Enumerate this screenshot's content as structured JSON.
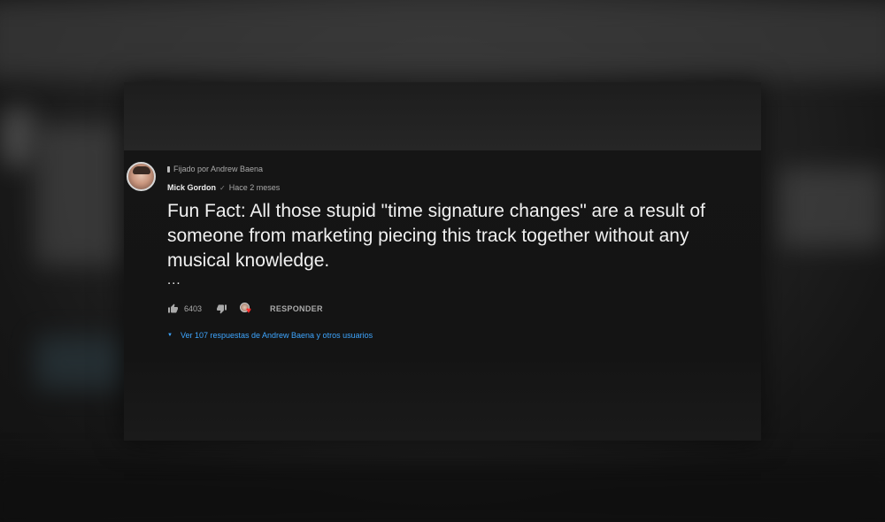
{
  "comment": {
    "pinned_label": "Fijado por Andrew Baena",
    "author": "Mick Gordon",
    "verified_icon": "check-icon",
    "time": "Hace 2 meses",
    "text": "Fun Fact: All those stupid \"time signature changes\" are a result of someone from marketing piecing this track together without any musical knowledge.",
    "more": "...",
    "likes": "6403",
    "reply_label": "RESPONDER",
    "view_replies": "Ver 107 respuestas de Andrew Baena y otros usuarios"
  },
  "colors": {
    "link": "#3ea6ff",
    "heart": "#ff2a2a",
    "text": "#f1f1f1",
    "muted": "#aaaaaa"
  }
}
